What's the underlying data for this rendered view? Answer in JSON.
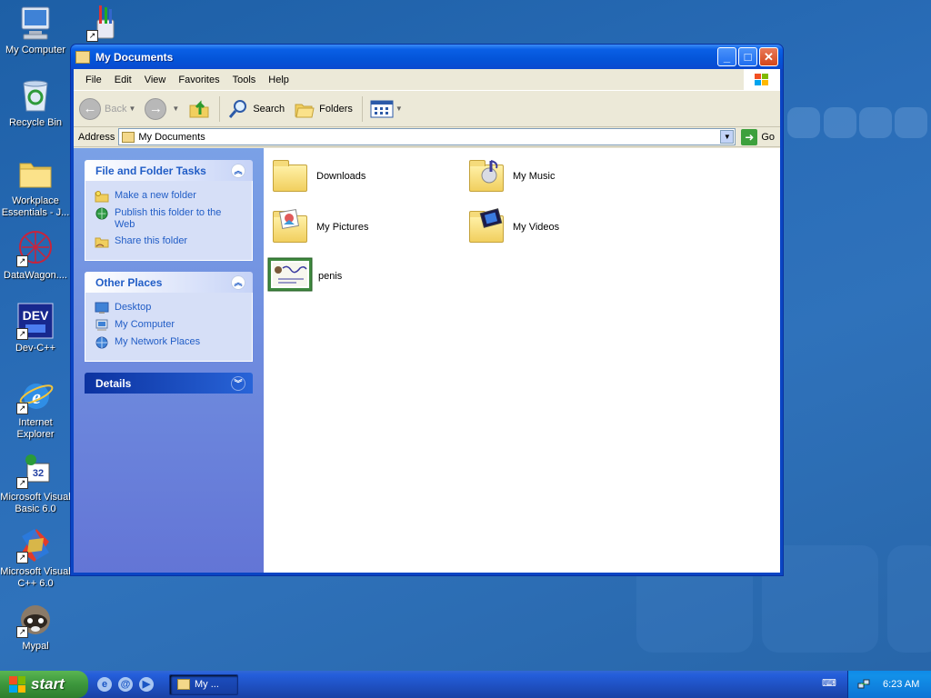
{
  "desktop": {
    "icons": [
      {
        "label": "My Computer"
      },
      {
        "label": "Recycle Bin"
      },
      {
        "label": "Workplace Essentials - J..."
      },
      {
        "label": "DataWagon...."
      },
      {
        "label": "Dev-C++"
      },
      {
        "label": "Internet Explorer"
      },
      {
        "label": "Microsoft Visual Basic 6.0"
      },
      {
        "label": "Microsoft Visual C++ 6.0"
      },
      {
        "label": "Mypal"
      }
    ]
  },
  "window": {
    "title": "My Documents",
    "menu": [
      "File",
      "Edit",
      "View",
      "Favorites",
      "Tools",
      "Help"
    ],
    "toolbar": {
      "back": "Back",
      "search": "Search",
      "folders": "Folders"
    },
    "address": {
      "label": "Address",
      "value": "My Documents",
      "go": "Go"
    },
    "taskpane": {
      "file_folder_tasks": {
        "title": "File and Folder Tasks",
        "items": [
          "Make a new folder",
          "Publish this folder to the Web",
          "Share this folder"
        ]
      },
      "other_places": {
        "title": "Other Places",
        "items": [
          "Desktop",
          "My Computer",
          "My Network Places"
        ]
      },
      "details": {
        "title": "Details"
      }
    },
    "files": [
      {
        "name": "Downloads",
        "type": "folder"
      },
      {
        "name": "My Music",
        "type": "folder"
      },
      {
        "name": "My Pictures",
        "type": "folder"
      },
      {
        "name": "My Videos",
        "type": "folder"
      },
      {
        "name": "penis",
        "type": "image"
      }
    ]
  },
  "taskbar": {
    "start": "start",
    "task_button": "My ...",
    "clock": "6:23 AM"
  },
  "colors": {
    "titlebar": "#0454d8",
    "taskpane": "#6375d6",
    "start": "#3c963c",
    "link": "#215dc6"
  }
}
